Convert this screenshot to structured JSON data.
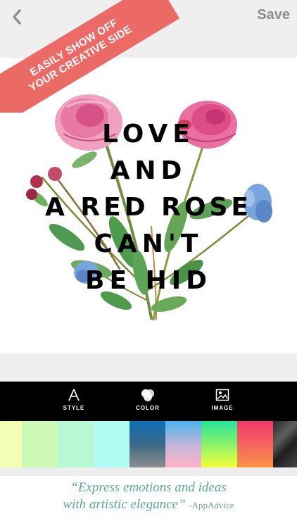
{
  "header": {
    "back_icon": "chevron-left-icon",
    "save_label": "Save",
    "ribbon_line1": "EASILY SHOW OFF",
    "ribbon_line2": "YOUR CREATIVE SIDE",
    "ribbon_color": "#ec6a66"
  },
  "artwork": {
    "lines": [
      "LOVE",
      "AND",
      "A RED ROSE",
      "CAN'T",
      "BE HID"
    ],
    "flower_colors": {
      "peony": "#e0588f",
      "blue_flower": "#6f9ad6",
      "leaf": "#5a9e4c",
      "berry": "#b1304d"
    }
  },
  "toolbar": {
    "style_label": "STYLE",
    "style_icon": "letter-a-icon",
    "color_label": "COLOR",
    "color_icon": "color-circles-icon",
    "image_label": "IMAGE",
    "image_icon": "image-icon"
  },
  "swatches": [
    {
      "name": "pale-yellow",
      "fill": "#f3ffb3"
    },
    {
      "name": "pale-green",
      "fill": "#ccf9b5"
    },
    {
      "name": "mint",
      "fill": "#b8f8d2"
    },
    {
      "name": "pale-cyan",
      "fill": "#b2fcf6"
    },
    {
      "name": "blue-gray-gradient",
      "fill": "linear-gradient(180deg,#0d6fb5 0%,#3b6a86 50%,#8d8d8d 100%)"
    },
    {
      "name": "blue-pink-gradient",
      "fill": "linear-gradient(180deg,#4bb3ee 0%,#c8b6d8 55%,#ffb2c6 100%)"
    },
    {
      "name": "green-yellow-gradient",
      "fill": "linear-gradient(180deg,#27e49a 0%,#8af36a 50%,#f5ff3a 100%)"
    },
    {
      "name": "red-orange-gradient",
      "fill": "linear-gradient(180deg,#f0386b 0%,#f5645f 50%,#f89446 100%)"
    },
    {
      "name": "black-marble",
      "fill": "linear-gradient(135deg,#2a2a2a 0%,#5e5e5e 35%,#1e1e1e 60%,#454545 100%)"
    }
  ],
  "quote": {
    "line1": "“Express emotions and ideas",
    "line2": "with artistic elegance”",
    "attribution": "-AppAdvice"
  }
}
